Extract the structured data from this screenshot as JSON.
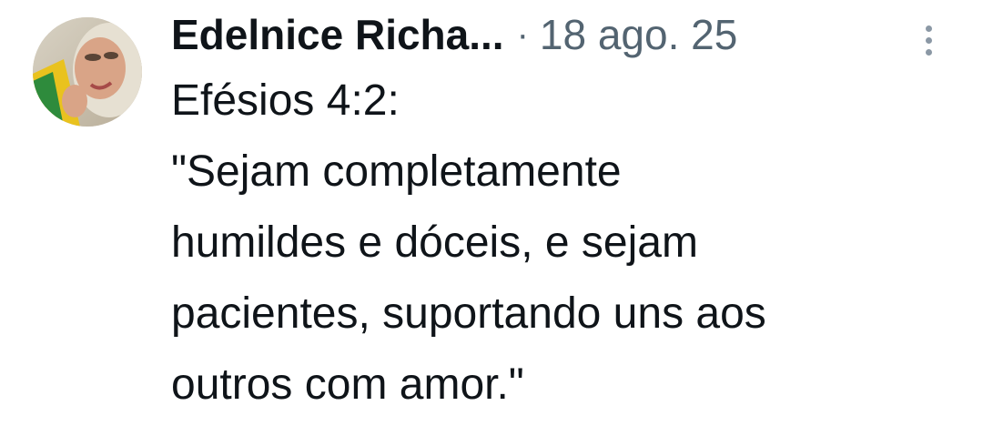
{
  "post": {
    "author_name": "Edelnice Richa...",
    "separator": "·",
    "timestamp": "18 ago. 25",
    "more_icon": "more-vertical-icon",
    "lines": [
      "Efésios 4:2:",
      "\"Sejam completamente",
      "humildes e dóceis, e sejam",
      "pacientes, suportando uns aos",
      "outros com amor.\""
    ]
  },
  "colors": {
    "text_primary": "#0f1419",
    "text_secondary": "#536471"
  }
}
